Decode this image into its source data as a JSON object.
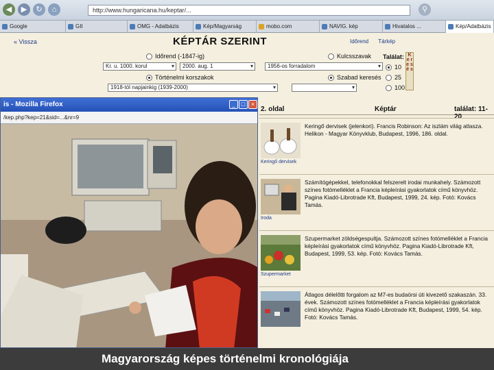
{
  "browser": {
    "url": "http://www.hungaricana.hu/keptar/...",
    "tabs": [
      {
        "label": "Google"
      },
      {
        "label": "GII"
      },
      {
        "label": "OMG - Adatbázis"
      },
      {
        "label": "Kép/Magyarság"
      },
      {
        "label": "mobo.com"
      },
      {
        "label": "NAVIG. kép"
      },
      {
        "label": "Hivatalos ..."
      },
      {
        "label": "Kép/Adatbázis"
      }
    ]
  },
  "page": {
    "back_link": "« Vissza",
    "title": "KÉPTÁR SZERINT",
    "top_links": [
      "Időrend",
      "Tárkép"
    ],
    "search": {
      "idorend_label": "Időrend (-1847-ig)",
      "from_value": "Kr. u. 1000. korul",
      "to_value": "2000. aug. 1",
      "kulcsszavak_label": "Kulcsszavak",
      "kulcsszo_value": "1956-os forradalom",
      "tortenelmi_label": "Történelmi korszakok",
      "korszak_value": "1918-tól napjainkig (1939-2000)",
      "szabad_label": "Szabad keresés",
      "talalat_label": "Találat:",
      "talalat_opts": [
        "10",
        "25",
        "100"
      ],
      "vertical_letters": "K e r e s é s"
    },
    "results": {
      "page_label": "2. oldal",
      "section_label": "Képtár",
      "hits_label": "találat: 11-20",
      "items": [
        {
          "caption": "Keringő dervisek",
          "text": "Keringő dervisek (jelenkori). Francis Robinson: Az iszlám világ atlasza. Helikon - Magyar Könyvklub, Budapest, 1996, 186. oldal."
        },
        {
          "caption": "Iroda",
          "text": "Számítógépekkel, telefonokkal felszerelt irodai munkahely. Számozott színes fotómelléklet a Francia képleírási gyakorlatok című könyvhöz. Pagina Kiadó-Librotrade Kft, Budapest, 1999, 24. kép. Fotó: Kovács Tamás."
        },
        {
          "caption": "Szupermarket",
          "text": "Szupermarket zöldségespultja. Számozott színes fotómelléklet a Francia képleírási gyakorlatok című könyvhöz. Pagina Kiadó-Librotrade Kft, Budapest, 1999, 53. kép. Fotó: Kovács Tamás."
        },
        {
          "caption": "",
          "text": "Átlagos délelőtti forgalom az M7-es budaörsi úti kivezető szakaszán. 33. évek. Számozott színes fotómelléklet a Francia képleírási gyakorlatok című könyvhöz. Pagina Kiadó-Librotrade Kft, Budapest, 1999, 54. kép. Fotó: Kovács Tamás."
        }
      ]
    }
  },
  "popup": {
    "title": "is - Mozilla Firefox",
    "address": "/kep.php?kep=21&sid=...&nr=9"
  },
  "footer": {
    "caption": "Magyarország képes történelmi kronológiája"
  }
}
